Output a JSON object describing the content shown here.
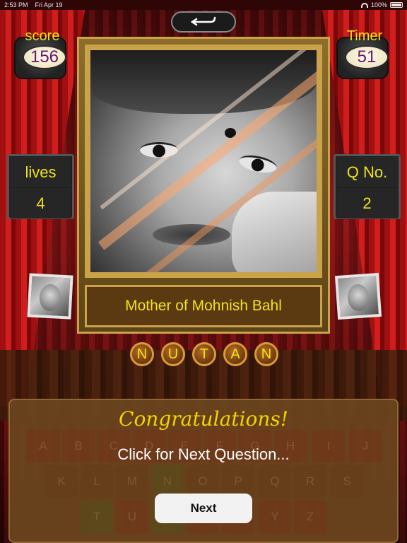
{
  "status_bar": {
    "time": "2:53 PM",
    "date": "Fri Apr 19",
    "battery": "100%"
  },
  "score": {
    "label": "score",
    "value": "156"
  },
  "timer": {
    "label": "Timer",
    "value": "51"
  },
  "lives": {
    "label": "lives",
    "value": "4"
  },
  "question_no": {
    "label": "Q No.",
    "value": "2"
  },
  "clue": "Mother of Mohnish Bahl",
  "answer_letters": [
    "N",
    "U",
    "T",
    "A",
    "N"
  ],
  "keyboard": {
    "rows": [
      [
        "A",
        "B",
        "C",
        "D",
        "E",
        "F",
        "G",
        "H",
        "I",
        "J"
      ],
      [
        "K",
        "L",
        "M",
        "N",
        "O",
        "P",
        "Q",
        "R",
        "S"
      ],
      [
        "T",
        "U",
        "V",
        "W",
        "X",
        "Y",
        "Z"
      ]
    ]
  },
  "overlay": {
    "title": "Congratulations!",
    "prompt": "Click for Next Question...",
    "next_label": "Next"
  },
  "colors": {
    "accent_yellow": "#f3e21a",
    "score_purple": "#6a1470",
    "curtain_red": "#c81a1a"
  }
}
